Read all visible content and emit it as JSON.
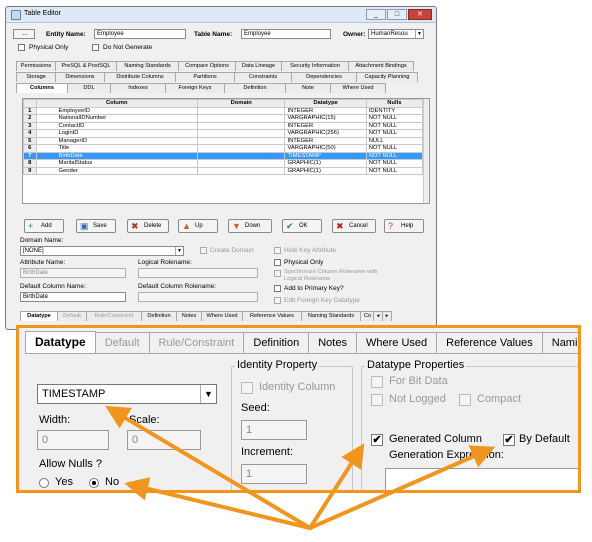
{
  "window": {
    "title": "Table Editor",
    "controls": [
      "_",
      "□",
      "✕"
    ]
  },
  "header": {
    "ellipsis_button": "...",
    "entity_name_label": "Entity Name:",
    "entity_name_value": "Employee",
    "table_name_label": "Table Name:",
    "table_name_value": "Employee",
    "owner_label": "Owner:",
    "owner_value": "HumanResou",
    "physical_only_label": "Physical Only",
    "do_not_generate_label": "Do Not Generate"
  },
  "tabs_row1": [
    "Permissions",
    "PreSQL & PostSQL",
    "Naming Standards",
    "Compare Options",
    "Data Lineage",
    "Security Information",
    "Attachment Bindings"
  ],
  "tabs_row2": [
    "Storage",
    "Dimensions",
    "Distribute Columns",
    "Partitions",
    "Constraints",
    "Dependencies",
    "Capacity Planning"
  ],
  "tabs_row3": [
    "Columns",
    "DDL",
    "Indexes",
    "Foreign Keys",
    "Definition",
    "Note",
    "Where Used"
  ],
  "grid": {
    "headers": [
      "",
      "Column",
      "Domain",
      "Datatype",
      "Nulls"
    ],
    "rows": [
      {
        "n": "1",
        "col": "EmployeeID",
        "domain": "",
        "type": "INTEGER",
        "nulls": "IDENTITY"
      },
      {
        "n": "2",
        "col": "NationalIDNumber",
        "domain": "",
        "type": "VARGRAPHIC(15)",
        "nulls": "NOT NULL"
      },
      {
        "n": "3",
        "col": "ContactID",
        "domain": "",
        "type": "INTEGER",
        "nulls": "NOT NULL"
      },
      {
        "n": "4",
        "col": "LoginID",
        "domain": "",
        "type": "VARGRAPHIC(256)",
        "nulls": "NOT NULL"
      },
      {
        "n": "5",
        "col": "ManagerID",
        "domain": "",
        "type": "INTEGER",
        "nulls": "NULL"
      },
      {
        "n": "6",
        "col": "Title",
        "domain": "",
        "type": "VARGRAPHIC(50)",
        "nulls": "NOT NULL"
      },
      {
        "n": "7",
        "col": "BirthDate",
        "domain": "",
        "type": "TIMESTAMP",
        "nulls": "NOT NULL"
      },
      {
        "n": "8",
        "col": "MaritalStatus",
        "domain": "",
        "type": "GRAPHIC(1)",
        "nulls": "NOT NULL"
      },
      {
        "n": "9",
        "col": "Gender",
        "domain": "",
        "type": "GRAPHIC(1)",
        "nulls": "NOT NULL"
      }
    ]
  },
  "buttons": {
    "add": "Add",
    "save": "Save",
    "delete": "Delete",
    "up": "Up",
    "down": "Down",
    "ok": "OK",
    "cancel": "Cancel",
    "help": "Help"
  },
  "details": {
    "domain_name_label": "Domain Name:",
    "domain_name_value": "[NONE]",
    "create_domain_label": "Create Domain",
    "hide_key_attr_label": "Hide Key Attribute",
    "attribute_name_label": "Attribute Name:",
    "attribute_name_value": "BirthDate",
    "logical_rolename_label": "Logical Rolename:",
    "physical_only_label": "Physical Only",
    "synch_label": "Synchronize Column Rolename with Logical Rolename",
    "default_column_name_label": "Default Column Name:",
    "default_column_name_value": "BirthDate",
    "default_column_rolename_label": "Default Column Rolename:",
    "add_primary_key_label": "Add to Primary Key?",
    "edit_fk_datatype_label": "Edit Foreign Key Datatype"
  },
  "small_tabs": [
    "Datatype",
    "Default",
    "Rule/Constraint",
    "Definition",
    "Notes",
    "Where Used",
    "Reference Values",
    "Naming Standards",
    "Co"
  ],
  "zoom": {
    "tabs": [
      "Datatype",
      "Default",
      "Rule/Constraint",
      "Definition",
      "Notes",
      "Where Used",
      "Reference Values",
      "Naming"
    ],
    "datatype_value": "TIMESTAMP",
    "width_label": "Width:",
    "width_value": "0",
    "scale_label": "Scale:",
    "scale_value": "0",
    "allow_nulls_label": "Allow Nulls ?",
    "yes_label": "Yes",
    "no_label": "No",
    "identity_title": "Identity Property",
    "identity_column_label": "Identity Column",
    "seed_label": "Seed:",
    "seed_value": "1",
    "increment_label": "Increment:",
    "increment_value": "1",
    "dtprops_title": "Datatype Properties",
    "for_bit_data_label": "For Bit Data",
    "not_logged_label": "Not Logged",
    "compact_label": "Compact",
    "generated_column_label": "Generated Column",
    "by_default_label": "By Default",
    "generation_expr_label": "Generation Expression:"
  },
  "colors": {
    "accent": "#f0961e",
    "selection": "#3399ff"
  }
}
